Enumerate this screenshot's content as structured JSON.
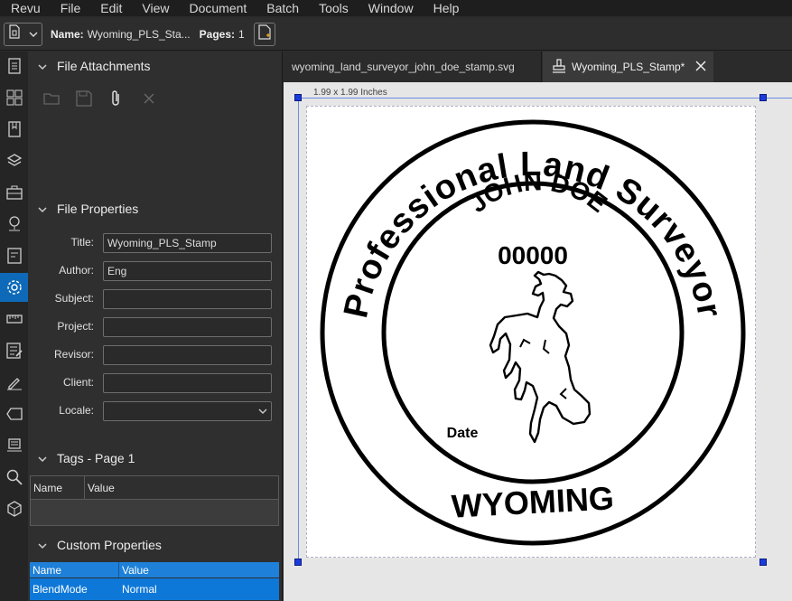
{
  "menu": [
    "Revu",
    "File",
    "Edit",
    "View",
    "Document",
    "Batch",
    "Tools",
    "Window",
    "Help"
  ],
  "toolbar": {
    "name_label": "Name:",
    "name_value": "Wyoming_PLS_Sta...",
    "pages_label": "Pages:",
    "pages_value": "1"
  },
  "rail_icons": [
    "thumbnails-icon",
    "grid-icon",
    "bookmarks-icon",
    "layers-icon",
    "toolchest-icon",
    "places-icon",
    "markups-icon",
    "properties-icon",
    "measurements-icon",
    "forms-icon",
    "signatures-icon",
    "tags-icon",
    "sets-icon",
    "search-icon",
    "3d-icon"
  ],
  "file_attachments": {
    "title": "File Attachments"
  },
  "file_properties": {
    "title": "File Properties",
    "fields": [
      {
        "label": "Title:",
        "value": "Wyoming_PLS_Stamp"
      },
      {
        "label": "Author:",
        "value": "Eng"
      },
      {
        "label": "Subject:",
        "value": ""
      },
      {
        "label": "Project:",
        "value": ""
      },
      {
        "label": "Revisor:",
        "value": ""
      },
      {
        "label": "Client:",
        "value": ""
      },
      {
        "label": "Locale:",
        "value": ""
      }
    ]
  },
  "tags": {
    "title": "Tags - Page 1",
    "columns": [
      "Name",
      "Value"
    ]
  },
  "custom_properties": {
    "title": "Custom Properties",
    "columns": [
      "Name",
      "Value"
    ],
    "rows": [
      {
        "name": "BlendMode",
        "value": "Normal"
      }
    ]
  },
  "tabs": [
    {
      "label": "wyoming_land_surveyor_john_doe_stamp.svg"
    },
    {
      "label": "Wyoming_PLS_Stamp*"
    }
  ],
  "document": {
    "dimensions": "1.99 x 1.99 Inches",
    "stamp": {
      "arc_text": "Professional Land Surveyor",
      "name": "JOHN DOE",
      "number": "00000",
      "date_label": "Date",
      "state": "WYOMING"
    }
  },
  "colors": {
    "accent": "#0e78d8",
    "selection_handle": "#1a3cdc"
  }
}
